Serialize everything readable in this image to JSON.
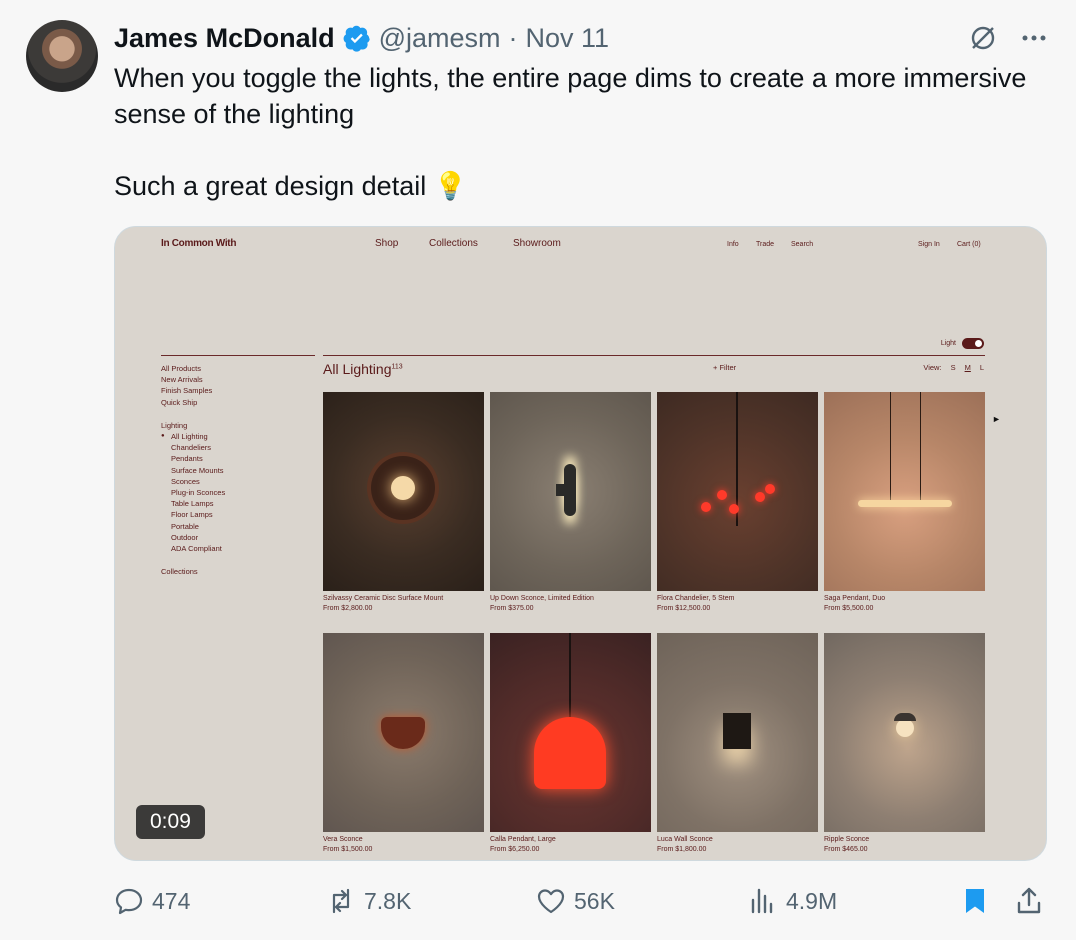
{
  "tweet": {
    "author_name": "James McDonald",
    "handle": "@jamesm",
    "separator": "·",
    "date": "Nov 11",
    "text_line1": "When you toggle the lights, the entire page dims to create a more immersive sense of the lighting",
    "text_line2": "Such a great design detail",
    "emoji": "💡"
  },
  "video": {
    "timer": "0:09",
    "site": {
      "logo": "In Common With",
      "nav_main": [
        "Shop",
        "Collections",
        "Showroom"
      ],
      "nav_right": [
        "Info",
        "Trade",
        "Search"
      ],
      "nav_account": [
        "Sign In",
        "Cart (0)"
      ],
      "light_label": "Light",
      "sidebar_group1": [
        "All Products",
        "New Arrivals",
        "Finish Samples",
        "Quick Ship"
      ],
      "sidebar_lighting": "Lighting",
      "sidebar_lighting_items": [
        "All Lighting",
        "Chandeliers",
        "Pendants",
        "Surface Mounts",
        "Sconces",
        "Plug-in Sconces",
        "Table Lamps",
        "Floor Lamps",
        "Portable",
        "Outdoor",
        "ADA Compliant"
      ],
      "sidebar_collections": "Collections",
      "grid_title": "All Lighting",
      "grid_count": "113",
      "filter_label": "+ Filter",
      "view_label": "View:",
      "view_options": [
        "S",
        "M",
        "L"
      ],
      "products": [
        {
          "name": "Szilvassy Ceramic Disc Surface Mount",
          "price": "From $2,800.00"
        },
        {
          "name": "Up Down Sconce, Limited Edition",
          "price": "From $375.00"
        },
        {
          "name": "Flora Chandelier, 5 Stem",
          "price": "From $12,500.00"
        },
        {
          "name": "Saga Pendant, Duo",
          "price": "From $5,500.00"
        },
        {
          "name": "Vera Sconce",
          "price": "From $1,500.00"
        },
        {
          "name": "Calla Pendant, Large",
          "price": "From $6,250.00"
        },
        {
          "name": "Luca Wall Sconce",
          "price": "From $1,800.00"
        },
        {
          "name": "Ripple Sconce",
          "price": "From $465.00"
        }
      ]
    }
  },
  "metrics": {
    "replies": "474",
    "reposts": "7.8K",
    "likes": "56K",
    "views": "4.9M"
  },
  "colors": {
    "verified": "#1d9bf0",
    "bookmark_active": "#1d9bf0",
    "muted": "#536471"
  }
}
